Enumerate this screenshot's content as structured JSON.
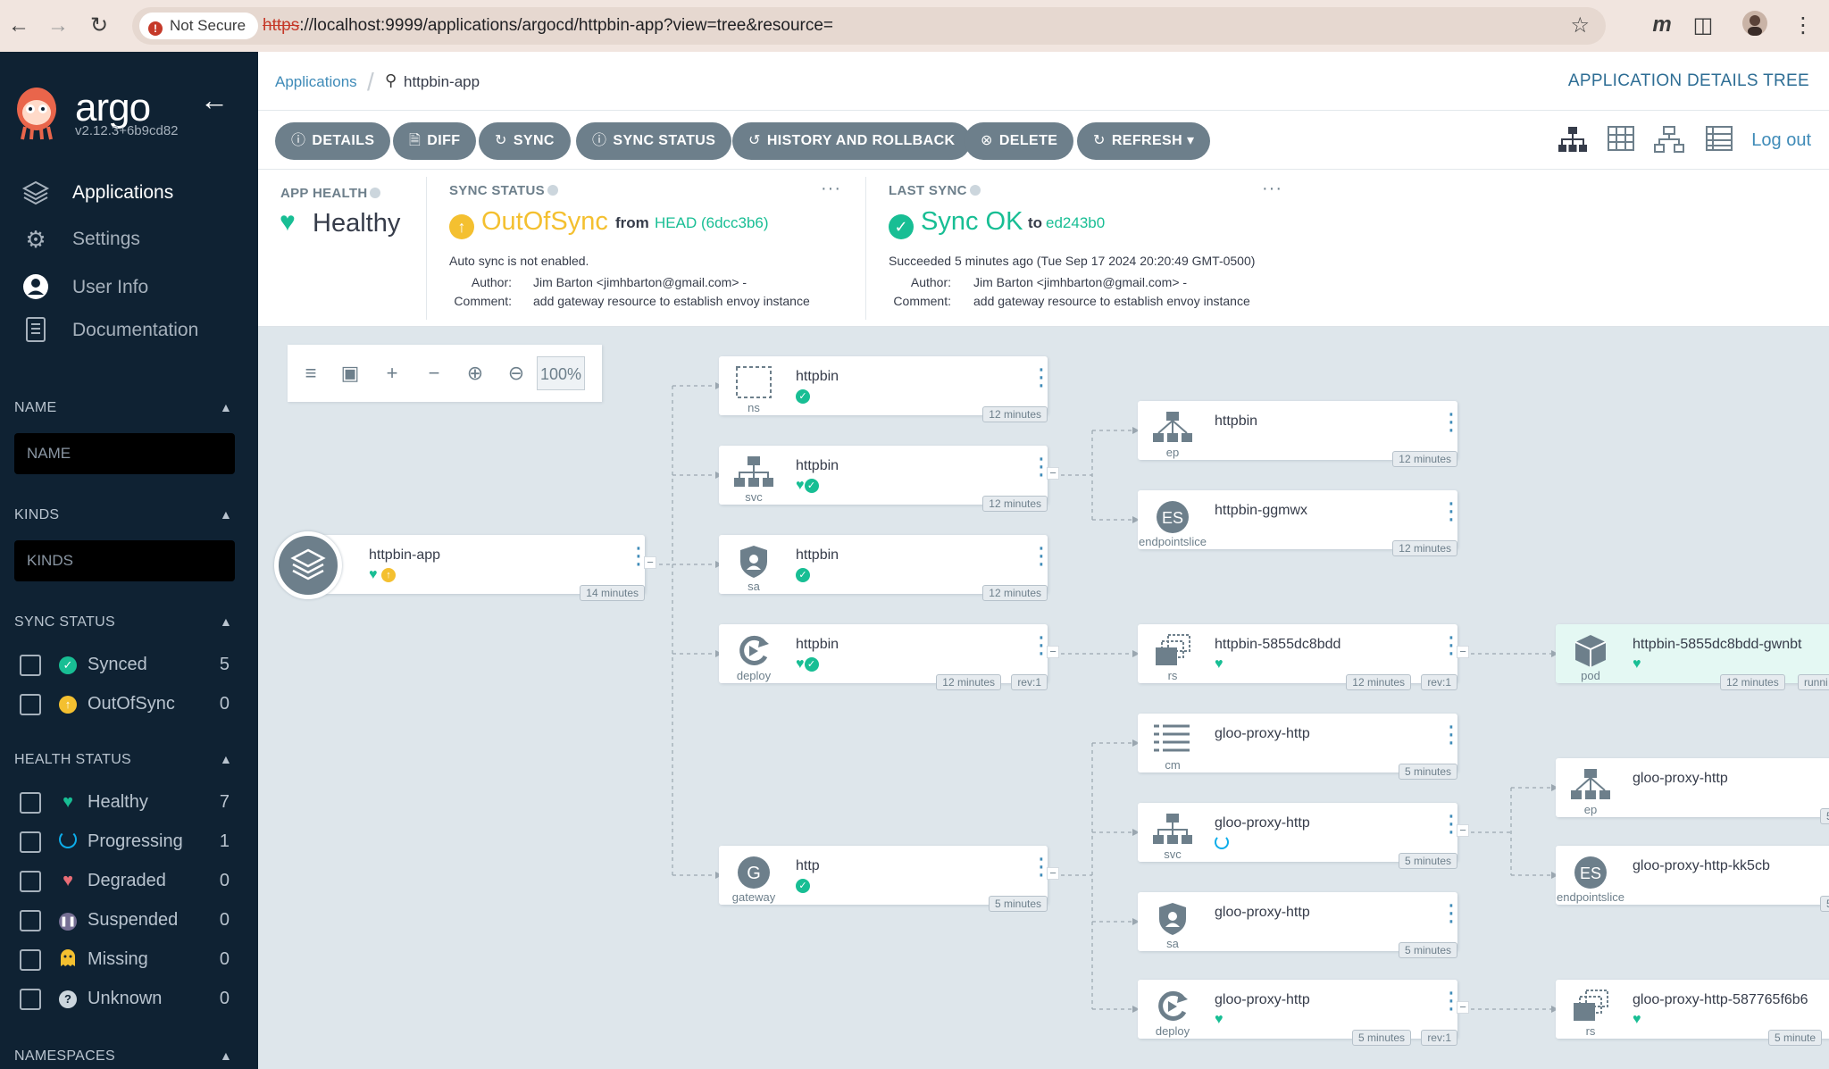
{
  "browser": {
    "not_secure": "Not Secure",
    "url_proto": "https",
    "url_rest": "://localhost:9999/applications/argocd/httpbin-app?view=tree&resource="
  },
  "sidebar": {
    "logo": "argo",
    "version": "v2.12.3+6b9cd82",
    "nav": [
      {
        "label": "Applications",
        "icon": "layers-icon"
      },
      {
        "label": "Settings",
        "icon": "gear-icon"
      },
      {
        "label": "User Info",
        "icon": "user-icon"
      },
      {
        "label": "Documentation",
        "icon": "document-icon"
      }
    ],
    "name_filter": {
      "title": "NAME",
      "placeholder": "NAME"
    },
    "kinds_filter": {
      "title": "KINDS",
      "placeholder": "KINDS"
    },
    "sync_status": {
      "title": "SYNC STATUS",
      "options": [
        {
          "label": "Synced",
          "count": "5",
          "color": "#18be94"
        },
        {
          "label": "OutOfSync",
          "count": "0",
          "color": "#f4c030"
        }
      ]
    },
    "health_status": {
      "title": "HEALTH STATUS",
      "options": [
        {
          "label": "Healthy",
          "count": "7",
          "color": "#18be94"
        },
        {
          "label": "Progressing",
          "count": "1",
          "color": "#0dadea"
        },
        {
          "label": "Degraded",
          "count": "0",
          "color": "#e96d76"
        },
        {
          "label": "Suspended",
          "count": "0",
          "color": "#766f94"
        },
        {
          "label": "Missing",
          "count": "0",
          "color": "#f4c030"
        },
        {
          "label": "Unknown",
          "count": "0",
          "color": "#ccd6dd"
        }
      ]
    },
    "namespaces_title": "NAMESPACES"
  },
  "header": {
    "breadcrumb_link": "Applications",
    "breadcrumb_current": "httpbin-app",
    "title": "APPLICATION DETAILS TREE"
  },
  "toolbar": {
    "buttons": [
      "DETAILS",
      "DIFF",
      "SYNC",
      "SYNC STATUS",
      "HISTORY AND ROLLBACK",
      "DELETE",
      "REFRESH"
    ],
    "logout": "Log out"
  },
  "status": {
    "app_health": {
      "label": "APP HEALTH",
      "value": "Healthy"
    },
    "sync_status": {
      "label": "SYNC STATUS",
      "value": "OutOfSync",
      "from": "from",
      "revision": "HEAD (6dcc3b6)",
      "note": "Auto sync is not enabled.",
      "author_label": "Author:",
      "author": "Jim Barton <jimhbarton@gmail.com> -",
      "comment_label": "Comment:",
      "comment": "add gateway resource to establish envoy instance"
    },
    "last_sync": {
      "label": "LAST SYNC",
      "value": "Sync OK",
      "to": "to",
      "revision": "ed243b0",
      "note": "Succeeded 5 minutes ago (Tue Sep 17 2024 20:20:49 GMT-0500)",
      "author_label": "Author:",
      "author": "Jim Barton <jimhbarton@gmail.com> -",
      "comment_label": "Comment:",
      "comment": "add gateway resource to establish envoy instance"
    },
    "more": "···"
  },
  "canvas": {
    "zoom": "100%",
    "colors": {
      "healthy": "#18be94",
      "outofsync": "#f4c030",
      "progressing": "#0dadea",
      "accent": "#3f8bb8"
    },
    "nodes": [
      {
        "id": "root",
        "name": "httpbin-app",
        "kind": "",
        "age": "14 minutes",
        "status": [
          "heart",
          "oos"
        ]
      },
      {
        "id": "ns",
        "name": "httpbin",
        "kind": "ns",
        "age": "12 minutes",
        "status": [
          "ok"
        ]
      },
      {
        "id": "svc",
        "name": "httpbin",
        "kind": "svc",
        "age": "12 minutes",
        "status": [
          "heart",
          "ok"
        ]
      },
      {
        "id": "sa",
        "name": "httpbin",
        "kind": "sa",
        "age": "12 minutes",
        "status": [
          "ok"
        ]
      },
      {
        "id": "deploy",
        "name": "httpbin",
        "kind": "deploy",
        "age": "12 minutes",
        "rev": "rev:1",
        "status": [
          "heart",
          "ok"
        ]
      },
      {
        "id": "gateway",
        "name": "http",
        "kind": "gateway",
        "age": "5 minutes",
        "status": [
          "ok"
        ]
      },
      {
        "id": "ep",
        "name": "httpbin",
        "kind": "ep",
        "age": "12 minutes",
        "status": []
      },
      {
        "id": "eps",
        "name": "httpbin-ggmwx",
        "kind": "endpointslice",
        "age": "12 minutes",
        "status": []
      },
      {
        "id": "rs",
        "name": "httpbin-5855dc8bdd",
        "kind": "rs",
        "age": "12 minutes",
        "rev": "rev:1",
        "status": [
          "heart"
        ]
      },
      {
        "id": "cm",
        "name": "gloo-proxy-http",
        "kind": "cm",
        "age": "5 minutes",
        "status": []
      },
      {
        "id": "gsvc",
        "name": "gloo-proxy-http",
        "kind": "svc",
        "age": "5 minutes",
        "status": [
          "prog"
        ]
      },
      {
        "id": "gsa",
        "name": "gloo-proxy-http",
        "kind": "sa",
        "age": "5 minutes",
        "status": []
      },
      {
        "id": "gdeploy",
        "name": "gloo-proxy-http",
        "kind": "deploy",
        "age": "5 minutes",
        "rev": "rev:1",
        "status": [
          "heart"
        ]
      },
      {
        "id": "pod",
        "name": "httpbin-5855dc8bdd-gwnbt",
        "kind": "pod",
        "age": "12 minutes",
        "extra": "runni",
        "status": [
          "heart"
        ]
      },
      {
        "id": "gep",
        "name": "gloo-proxy-http",
        "kind": "ep",
        "age": "5",
        "status": []
      },
      {
        "id": "geps",
        "name": "gloo-proxy-http-kk5cb",
        "kind": "endpointslice",
        "age": "5",
        "status": []
      },
      {
        "id": "grs",
        "name": "gloo-proxy-http-587765f6b6",
        "kind": "rs",
        "age": "5 minute",
        "status": [
          "heart"
        ]
      }
    ]
  }
}
